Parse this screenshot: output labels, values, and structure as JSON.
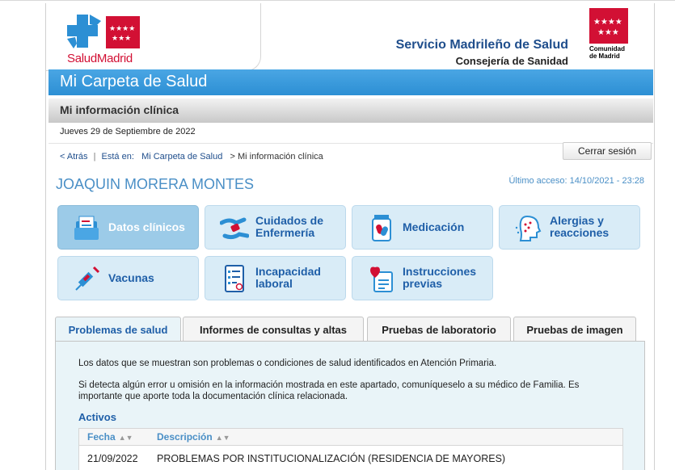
{
  "header": {
    "logo_salud": "Salud",
    "logo_madrid": "Madrid",
    "service_title": "Servicio Madrileño de Salud",
    "service_subtitle": "Consejería de Sanidad",
    "cm_line1": "Comunidad",
    "cm_line2": "de Madrid"
  },
  "app_title": "Mi Carpeta de Salud",
  "section_title": "Mi información clínica",
  "current_date": "Jueves 29 de Septiembre de 2022",
  "breadcrumb": {
    "back": "< Atrás",
    "separator": "|",
    "you_are_in": "Está en:",
    "home": "Mi Carpeta de Salud",
    "current": "> Mi información clínica"
  },
  "logout_label": "Cerrar sesión",
  "patient_name": "JOAQUIN MORERA MONTES",
  "last_access": "Último acceso: 14/10/2021 - 23:28",
  "tiles": [
    {
      "label": "Datos clínicos",
      "icon": "clinical-folder-icon"
    },
    {
      "label": "Cuidados de Enfermería",
      "icon": "nursing-hands-icon"
    },
    {
      "label": "Medicación",
      "icon": "medication-jar-icon"
    },
    {
      "label": "Alergias y reacciones",
      "icon": "allergy-head-icon"
    },
    {
      "label": "Vacunas",
      "icon": "syringe-icon"
    },
    {
      "label": "Incapacidad laboral",
      "icon": "work-leave-form-icon"
    },
    {
      "label": "Instrucciones previas",
      "icon": "heart-document-icon"
    }
  ],
  "tabs": [
    {
      "label": "Problemas de salud"
    },
    {
      "label": "Informes de consultas y altas"
    },
    {
      "label": "Pruebas de laboratorio"
    },
    {
      "label": "Pruebas de imagen"
    }
  ],
  "panel": {
    "intro": "Los datos que se muestran son problemas o condiciones de salud identificados en Atención Primaria.",
    "notice": "Si detecta algún error u omisión en la información mostrada en este apartado, comuníqueselo a su médico de Familia. Es importante que aporte toda la documentación clínica relacionada.",
    "active_heading": "Activos",
    "columns": {
      "date": "Fecha",
      "description": "Descripción"
    },
    "sort_glyph": "▲▼",
    "rows": [
      {
        "date": "21/09/2022",
        "description": "PROBLEMAS POR INSTITUCIONALIZACIÓN (RESIDENCIA DE MAYORES)"
      }
    ]
  },
  "colors": {
    "brand_blue": "#2c8fd4",
    "brand_red": "#d21034",
    "link_blue": "#1f5fa8",
    "tile_bg": "#d9ecf7"
  }
}
